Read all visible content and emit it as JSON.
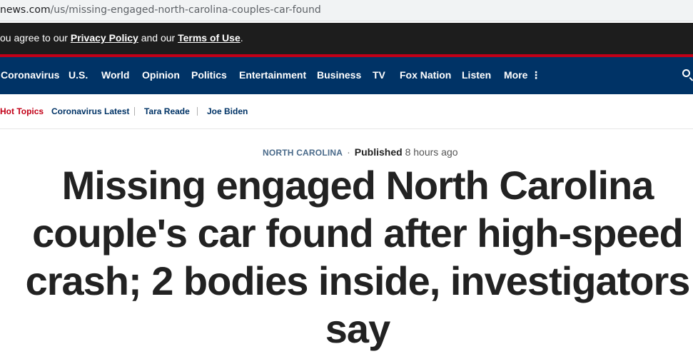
{
  "browser": {
    "url_host": "news.com",
    "url_path": "/us/missing-engaged-north-carolina-couples-car-found"
  },
  "consent": {
    "prefix": "ou agree to our ",
    "privacy_label": "Privacy Policy",
    "middle": " and our ",
    "terms_label": "Terms of Use",
    "suffix": "."
  },
  "nav": {
    "items": [
      "Coronavirus",
      "U.S.",
      "World",
      "Opinion",
      "Politics",
      "Entertainment",
      "Business",
      "TV",
      "Fox Nation",
      "Listen",
      "More"
    ]
  },
  "hot_topics": {
    "label": "Hot Topics",
    "items": [
      "Coronavirus Latest",
      "Tara Reade",
      "Joe Biden"
    ]
  },
  "article": {
    "category": "NORTH CAROLINA",
    "published_label": "Published",
    "published_time": "8 hours ago",
    "headline_lines": [
      "Missing engaged North Carolina",
      "couple's car found after high-speed",
      "crash; 2 bodies inside, investigators",
      "say"
    ]
  },
  "colors": {
    "nav_bg": "#003366",
    "accent_red": "#c20017",
    "topbar_bg": "#1d1d1d"
  }
}
